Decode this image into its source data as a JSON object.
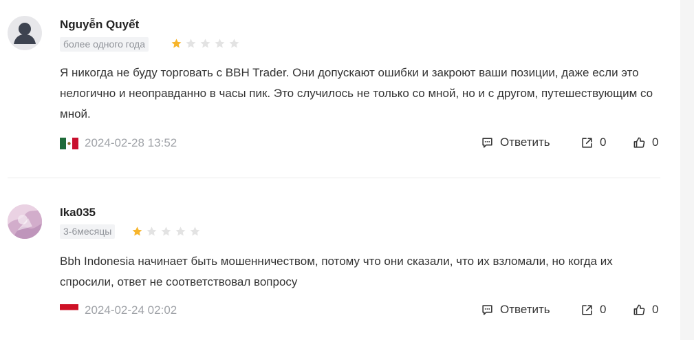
{
  "colors": {
    "star_active": "#f7b52c",
    "star_inactive": "#e3e3e3",
    "date_text": "#a0a3a8",
    "tag_bg": "#f2f3f5"
  },
  "actions": {
    "reply_label": "Ответить",
    "reply_icon": "comment-icon",
    "share_icon": "share-icon",
    "like_icon": "thumbs-up-icon"
  },
  "reviews": [
    {
      "username": "Nguyễn Quyết",
      "duration": "более одного года",
      "rating": 1,
      "rating_max": 5,
      "text": "Я никогда не буду торговать с BBH Trader. Они допускают ошибки и закроют ваши позиции, даже если это нелогично и неоправданно в часы пик. Это случилось не только со мной, но и с другом, путешествующим со мной.",
      "country_flag": "mexico-flag",
      "date": "2024-02-28 13:52",
      "share_count": "0",
      "like_count": "0"
    },
    {
      "username": "Ika035",
      "duration": "3-6месяцы",
      "rating": 1,
      "rating_max": 5,
      "text": "Bbh Indonesia начинает быть мошенничеством, потому что они сказали, что их взломали, но когда их спросили, ответ не соответствовал вопросу",
      "country_flag": "indonesia-flag",
      "date": "2024-02-24 02:02",
      "share_count": "0",
      "like_count": "0"
    }
  ]
}
